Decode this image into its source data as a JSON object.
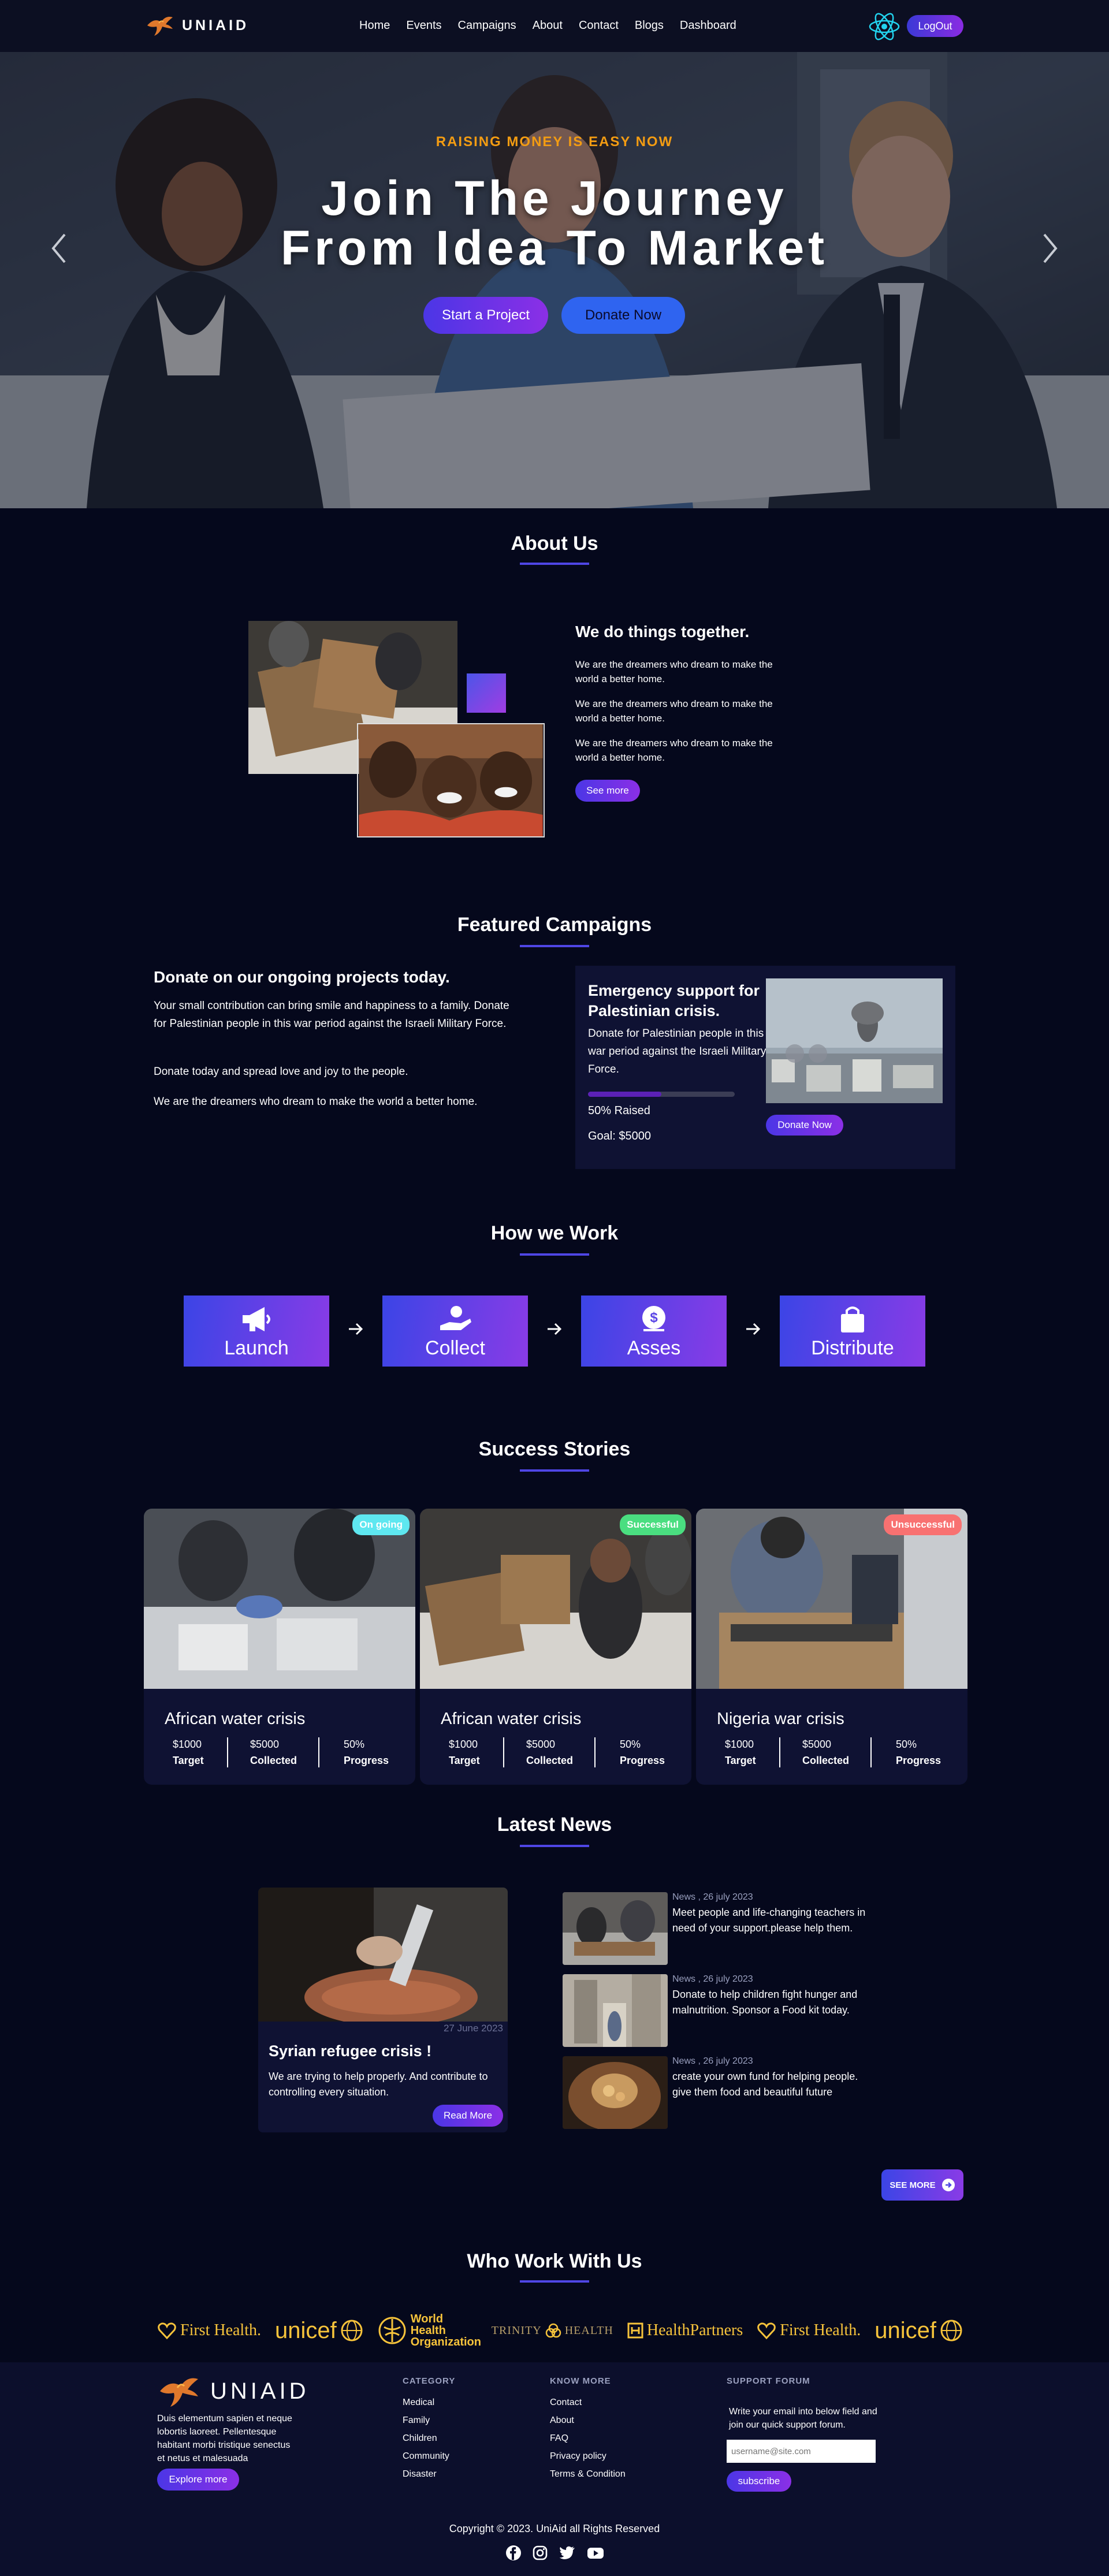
{
  "nav": {
    "brand": "UNIAID",
    "links": [
      "Home",
      "Events",
      "Campaigns",
      "About",
      "Contact",
      "Blogs",
      "Dashboard"
    ],
    "logout": "LogOut"
  },
  "hero": {
    "kicker": "RAISING MONEY IS EASY NOW",
    "title_line1": "Join The Journey",
    "title_line2": "From Idea To Market",
    "start_button": "Start a Project",
    "donate_button": "Donate Now"
  },
  "about": {
    "title": "About Us",
    "heading": "We do things together.",
    "paragraphs": [
      "We are the dreamers who dream to make the world a better home.",
      "We are the dreamers who dream to make the world a better home.",
      "We are the dreamers who dream to make the world a better home."
    ],
    "button": "See more"
  },
  "featured": {
    "title": "Featured Campaigns",
    "heading": "Donate on our ongoing projects today.",
    "paragraphs": [
      "Your small contribution can bring smile and happiness to a family. Donate for Palestinian people in this war period against the Israeli Military Force.",
      "Donate today and spread love and joy to the people.",
      "We are the dreamers who dream to make the world a better home."
    ],
    "campaign": {
      "title": "Emergency support for Palestinian crisis.",
      "description": "Donate for Palestinian people in this war period against the Israeli Military Force.",
      "progress": 0.5,
      "raised": "50% Raised",
      "goal": "Goal: $5000",
      "button": "Donate Now"
    }
  },
  "how": {
    "title": "How we Work",
    "steps": [
      {
        "label": "Launch",
        "icon": "megaphone-icon"
      },
      {
        "label": "Collect",
        "icon": "hand-coin-icon"
      },
      {
        "label": "Asses",
        "icon": "money-bag-icon"
      },
      {
        "label": "Distribute",
        "icon": "shopping-bag-icon"
      }
    ]
  },
  "stories": {
    "title": "Success Stories",
    "items": [
      {
        "badge": "On going",
        "badge_color": "#5ee7f0",
        "title": "African water crisis",
        "target": "$1000",
        "target_label": "Target",
        "collected": "$5000",
        "collected_label": "Collected",
        "progress": "50%",
        "progress_label": "Progress"
      },
      {
        "badge": "Successful",
        "badge_color": "#4ade80",
        "title": "African water crisis",
        "target": "$1000",
        "target_label": "Target",
        "collected": "$5000",
        "collected_label": "Collected",
        "progress": "50%",
        "progress_label": "Progress"
      },
      {
        "badge": "Unsuccessful",
        "badge_color": "#f87171",
        "title": "Nigeria war crisis",
        "target": "$1000",
        "target_label": "Target",
        "collected": "$5000",
        "collected_label": "Collected",
        "progress": "50%",
        "progress_label": "Progress"
      }
    ]
  },
  "news": {
    "title": "Latest News",
    "feature": {
      "date": "27 June 2023",
      "title": "Syrian refugee crisis !",
      "description": "We are trying to help properly. And contribute to controlling every situation.",
      "button": "Read More"
    },
    "items": [
      {
        "meta": "News , 26 july 2023",
        "text": "Meet people and life-changing teachers in need of your support.please help them."
      },
      {
        "meta": "News , 26 july 2023",
        "text": "Donate to help children fight hunger and malnutrition. Sponsor a Food kit today."
      },
      {
        "meta": "News , 26 july 2023",
        "text": "create your own fund for helping people. give them food and beautiful future"
      }
    ],
    "see_more": "SEE MORE"
  },
  "partners": {
    "title": "Who Work With Us",
    "logos": [
      "First Health.",
      "unicef",
      "World Health Organization",
      "TRINITY",
      "HEALTH",
      "HealthPartners",
      "First Health.",
      "unicef"
    ]
  },
  "footer": {
    "brand": "UNIAID",
    "about": "Duis elementum sapien et neque lobortis laoreet. Pellentesque habitant morbi tristique senectus et netus et malesuada",
    "explore": "Explore more",
    "category_title": "CATEGORY",
    "category": [
      "Medical",
      "Family",
      "Children",
      "Community",
      "Disaster"
    ],
    "know_title": "KNOW MORE",
    "know": [
      "Contact",
      "About",
      "FAQ",
      "Privacy policy",
      "Terms & Condition"
    ],
    "support_title": "SUPPORT FORUM",
    "support_text": "Write your email into below field and join our quick support forum.",
    "email_placeholder": "username@site.com",
    "subscribe": "subscribe",
    "copyright": "Copyright © 2023. UniAid all Rights Reserved"
  }
}
